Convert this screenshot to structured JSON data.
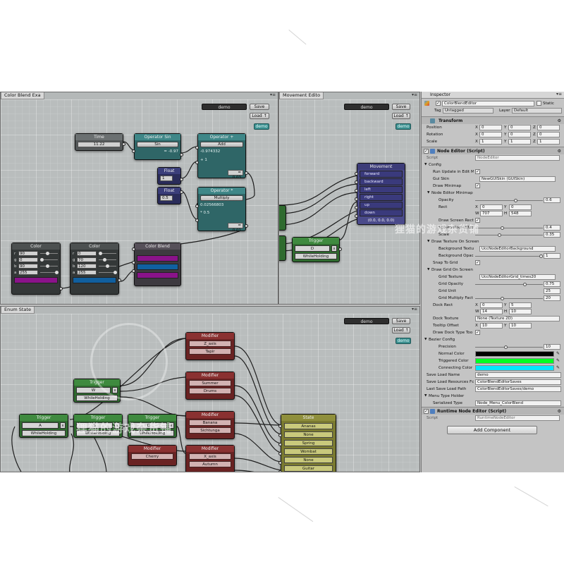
{
  "panels": {
    "color_blend": {
      "tab": "Color Blend Exa",
      "field": "demo",
      "save": "Save",
      "load": "Load ↑",
      "demo": "demo"
    },
    "movement": {
      "tab": "Movement Edito",
      "field": "demo",
      "save": "Save",
      "load": "Load ↑",
      "demo": "demo"
    },
    "enum_state": {
      "tab": "Enum State",
      "field": "demo",
      "save": "Save",
      "load": "Load ↑",
      "demo": "demo"
    }
  },
  "nodes": {
    "time": {
      "title": "Time",
      "value": "11.22"
    },
    "op_sin": {
      "title": "Operator Sin",
      "button": "Sin",
      "result": "= -0.97"
    },
    "op_add": {
      "title": "Operator +",
      "button": "Add",
      "a": "-0.974332",
      "b": "+ 1",
      "result": "= 0.03"
    },
    "float1": {
      "title": "Float",
      "value": "1"
    },
    "float2": {
      "title": "Float",
      "value": "0.5"
    },
    "op_mul": {
      "title": "Operator *",
      "button": "Multiply",
      "a": "0.02566803",
      "b": "* 0.5",
      "result": "= 0.01"
    },
    "color1": {
      "title": "Color",
      "r": "90",
      "g": "0",
      "b": "90",
      "a": "255",
      "swatch": "#8a138a"
    },
    "color2": {
      "title": "Color",
      "r": "0",
      "g": "70",
      "b": "120",
      "a": "255",
      "swatch": "#115f9e"
    },
    "blend": {
      "title": "Color Blend",
      "c1": "#8a138a",
      "c2": "#1060a0",
      "c3": "#8a138a"
    },
    "movement": {
      "title": "Movement",
      "rows": [
        "forward",
        "backward",
        "left",
        "right",
        "up",
        "down"
      ],
      "vector": "(0.0, 0.0, 0.0)"
    },
    "trig_move": {
      "title": "Trigger",
      "key": "D",
      "mode": "WhileHolding"
    },
    "trig_w": {
      "title": "Trigger",
      "key": "W",
      "mode": "WhileHolding"
    },
    "trig_a": {
      "title": "Trigger",
      "key": "A",
      "mode": "WhileHolding"
    },
    "trig_s": {
      "title": "Trigger",
      "key": "S",
      "mode": "WhileHolding"
    },
    "trig_d": {
      "title": "Trigger",
      "key": "D",
      "mode": "WhileHolding"
    },
    "mod1": {
      "title": "Modifier",
      "rows": [
        "Z_axis",
        "Tapir"
      ]
    },
    "mod2": {
      "title": "Modifier",
      "rows": [
        "Summer",
        "Drums"
      ]
    },
    "mod3": {
      "title": "Modifier",
      "rows": [
        "Banana",
        "Sichtunga"
      ]
    },
    "mod4": {
      "title": "Modifier",
      "rows": [
        "Cherry"
      ]
    },
    "mod5": {
      "title": "Modifier",
      "rows": [
        "X_axis",
        "Autumn"
      ]
    },
    "state": {
      "title": "State",
      "rows": [
        "Ananas",
        "None",
        "Spring",
        "Wombat",
        "None",
        "Guitar"
      ]
    },
    "close_glyph": "x"
  },
  "inspector": {
    "tab": "Inspector",
    "object_name": "ColorBlendEditor",
    "static_label": "Static",
    "tag_label": "Tag",
    "tag_value": "Untagged",
    "layer_label": "Layer",
    "layer_value": "Default",
    "transform": {
      "title": "Transform",
      "rows": [
        {
          "label": "Position",
          "x": "0",
          "y": "0",
          "z": "0"
        },
        {
          "label": "Rotation",
          "x": "0",
          "y": "0",
          "z": "0"
        },
        {
          "label": "Scale",
          "x": "1",
          "y": "1",
          "z": "1"
        }
      ]
    },
    "node_editor": {
      "title": "Node Editor (Script)",
      "script_label": "Script",
      "script_value": "NodeEditor",
      "config": "Config",
      "run_update": "Run Update in Edit M",
      "gui_skin_label": "Gui Skin",
      "gui_skin_value": "NewGUISkin (GUISkin)",
      "draw_minimap": "Draw Minimap",
      "minimap": "Node Editor Minimap",
      "opacity_label": "Opacity",
      "opacity_value": "0.6",
      "rect_label": "Rect",
      "rect_x": "0",
      "rect_y": "0",
      "rect_w": "707",
      "rect_h": "548",
      "draw_screen_rect": "Draw Screen Rect",
      "screen_rect_offs": "Screen Rect Offse",
      "screen_rect_offs_value": "0.4",
      "scale_label": "Scale",
      "scale_value": "0.35",
      "draw_texture": "Draw Texture On Screen",
      "bg_texture_label": "Background Textu",
      "bg_texture_value": "UccNodeEditorBackground",
      "bg_opacity_label": "Background Opac",
      "bg_opacity_value": "1",
      "snap_grid": "Snap To Grid",
      "draw_grid": "Draw Grid On Screen",
      "grid_texture_label": "Grid Texture",
      "grid_texture_value": "UccNodeEditorGrid_times20",
      "grid_opacity_label": "Grid Opacity",
      "grid_opacity_value": "0.75",
      "grid_unit_label": "Grid Unit",
      "grid_unit_value": "25",
      "grid_mult_label": "Grid Multiply Fact",
      "grid_mult_value": "20",
      "dock_rect_label": "Dock Rect",
      "dock_x": "0",
      "dock_y": "5",
      "dock_w": "14",
      "dock_h": "10",
      "dock_texture_label": "Dock Texture",
      "dock_texture_value": "None (Texture 2D)",
      "tooltip_offset_label": "Tooltip Offset",
      "tooltip_x": "10",
      "tooltip_y": "10",
      "draw_dock_tooltip": "Draw Dock Type Too",
      "bezier": "Bezier Config",
      "precision_label": "Precision",
      "precision_value": "10",
      "normal_color_label": "Normal Color",
      "normal_color": "#000000",
      "triggered_color_label": "Triggered Color",
      "triggered_color": "#00ff22",
      "connecting_color_label": "Connecting Color",
      "connecting_color": "#00e8ff",
      "save_load_name_label": "Save Load Name",
      "save_load_name_value": "demo",
      "save_load_res_label": "Save Load Resources Fc",
      "save_load_res_value": "ColorBlendEditorSaves",
      "last_save_label": "Last Save Load Path",
      "last_save_value": "ColorBlendEditorSaves/demo",
      "menu_type": "Menu Type Holder",
      "serialized_label": "Serialized Type",
      "serialized_value": "Node_Menu_ColorBlend"
    },
    "runtime": {
      "title": "Runtime Node Editor (Script)",
      "script_label": "Script",
      "script_value": "RuntimeNodeEditor"
    },
    "add_component": "Add Component"
  },
  "watermark": {
    "text": "狸猫的游戏杂货铺"
  }
}
